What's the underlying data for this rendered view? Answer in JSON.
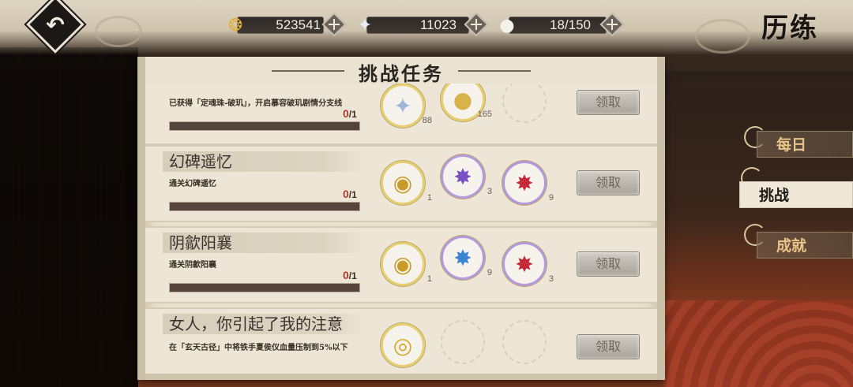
{
  "header": {
    "page_title": "历练",
    "back_glyph": "↶"
  },
  "resources": [
    {
      "name": "coins",
      "icon": "coin-icon",
      "value": "523541"
    },
    {
      "name": "crystals",
      "icon": "star-crystal-icon",
      "value": "11023"
    },
    {
      "name": "stamina",
      "icon": "rice-ball-icon",
      "value": "18/150"
    }
  ],
  "panel": {
    "title": "挑战任务"
  },
  "tasks": [
    {
      "name": "",
      "desc": "已获得「定魂珠-破玑」，开启慕容破玑剧情分支线",
      "current": "0",
      "total": "/1",
      "progress": 0,
      "rewards": [
        {
          "icon": "star-crystal-icon",
          "glyph": "✦",
          "qty": "88"
        },
        {
          "icon": "gold-egg-icon",
          "glyph": "●",
          "qty": "165"
        },
        {
          "icon": "empty-slot-icon",
          "glyph": "",
          "qty": ""
        }
      ],
      "claim_label": "领取"
    },
    {
      "name": "幻碑遥忆",
      "desc": "通关幻碑遥忆",
      "current": "0",
      "total": "/1",
      "progress": 0,
      "rewards": [
        {
          "icon": "gold-medallion-icon",
          "glyph": "◉",
          "qty": "1"
        },
        {
          "icon": "purple-crystal-icon",
          "glyph": "✸",
          "qty": "3"
        },
        {
          "icon": "red-crystal-icon",
          "glyph": "✸",
          "qty": "9"
        }
      ],
      "claim_label": "领取"
    },
    {
      "name": "阴歙阳襄",
      "desc": "通关阴歙阳襄",
      "current": "0",
      "total": "/1",
      "progress": 0,
      "rewards": [
        {
          "icon": "gold-medallion-icon",
          "glyph": "◉",
          "qty": "1"
        },
        {
          "icon": "blue-crystal-icon",
          "glyph": "✸",
          "qty": "9"
        },
        {
          "icon": "red-crystal-icon",
          "glyph": "✸",
          "qty": "3"
        }
      ],
      "claim_label": "领取"
    },
    {
      "name": "女人，你引起了我的注意",
      "desc": "在「玄天古径」中将铁手夏侯仪血量压制到5%以下",
      "current": "",
      "total": "",
      "progress": 0,
      "rewards": [
        {
          "icon": "coin-icon",
          "glyph": "◎",
          "qty": ""
        },
        {
          "icon": "empty-slot-icon",
          "glyph": "",
          "qty": ""
        },
        {
          "icon": "empty-slot-icon",
          "glyph": "",
          "qty": ""
        }
      ],
      "claim_label": "领取"
    }
  ],
  "tabs": [
    {
      "label": "每日",
      "active": false
    },
    {
      "label": "挑战",
      "active": true
    },
    {
      "label": "成就",
      "active": false
    }
  ]
}
